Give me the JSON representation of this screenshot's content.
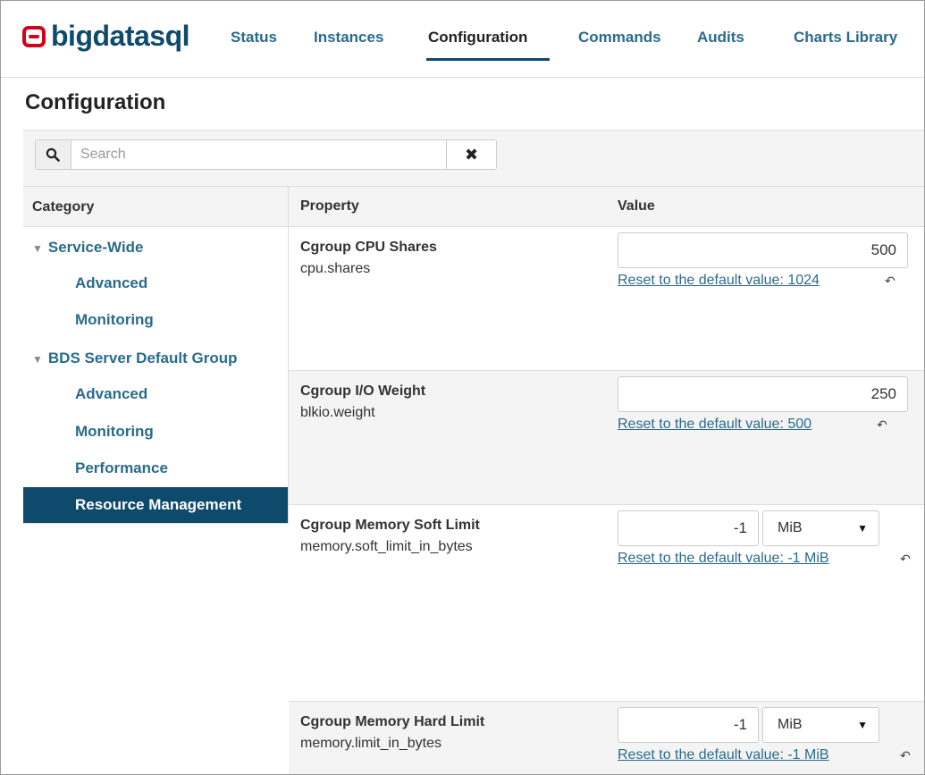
{
  "brand": {
    "name": "bigdatasql"
  },
  "nav": {
    "tabs": [
      "Status",
      "Instances",
      "Configuration",
      "Commands",
      "Audits",
      "Charts Library"
    ],
    "active": "Configuration"
  },
  "page": {
    "title": "Configuration"
  },
  "search": {
    "placeholder": "Search",
    "value": "",
    "clear_symbol": "✖"
  },
  "category": {
    "header": "Category",
    "groups": [
      {
        "label": "Service-Wide",
        "items": [
          "Advanced",
          "Monitoring"
        ]
      },
      {
        "label": "BDS Server Default Group",
        "items": [
          "Advanced",
          "Monitoring",
          "Performance",
          "Resource Management"
        ]
      }
    ],
    "active": "Resource Management"
  },
  "table": {
    "col_property": "Property",
    "col_value": "Value",
    "rows": [
      {
        "name": "Cgroup CPU Shares",
        "key": "cpu.shares",
        "value": "500",
        "unit": "",
        "reset": "Reset to the default value: 1024 "
      },
      {
        "name": "Cgroup I/O Weight",
        "key": "blkio.weight",
        "value": "250",
        "unit": "",
        "reset": "Reset to the default value: 500 "
      },
      {
        "name": "Cgroup Memory Soft Limit",
        "key": "memory.soft_limit_in_bytes",
        "value": "-1",
        "unit": "MiB",
        "reset": "Reset to the default value: -1 MiB "
      },
      {
        "name": "Cgroup Memory Hard Limit",
        "key": "memory.limit_in_bytes",
        "value": "-1",
        "unit": "MiB",
        "reset": "Reset to the default value: -1 MiB "
      }
    ]
  },
  "icons": {
    "brand": "oracle-logo-icon",
    "search": "magnifier-icon",
    "clear": "close-icon",
    "caret": "caret-down-icon",
    "reset": "undo-arrow-icon",
    "select": "dropdown-arrow-icon"
  },
  "colors": {
    "brand_red": "#d0021b",
    "primary": "#0e4a6b",
    "link": "#2a6b8c"
  }
}
